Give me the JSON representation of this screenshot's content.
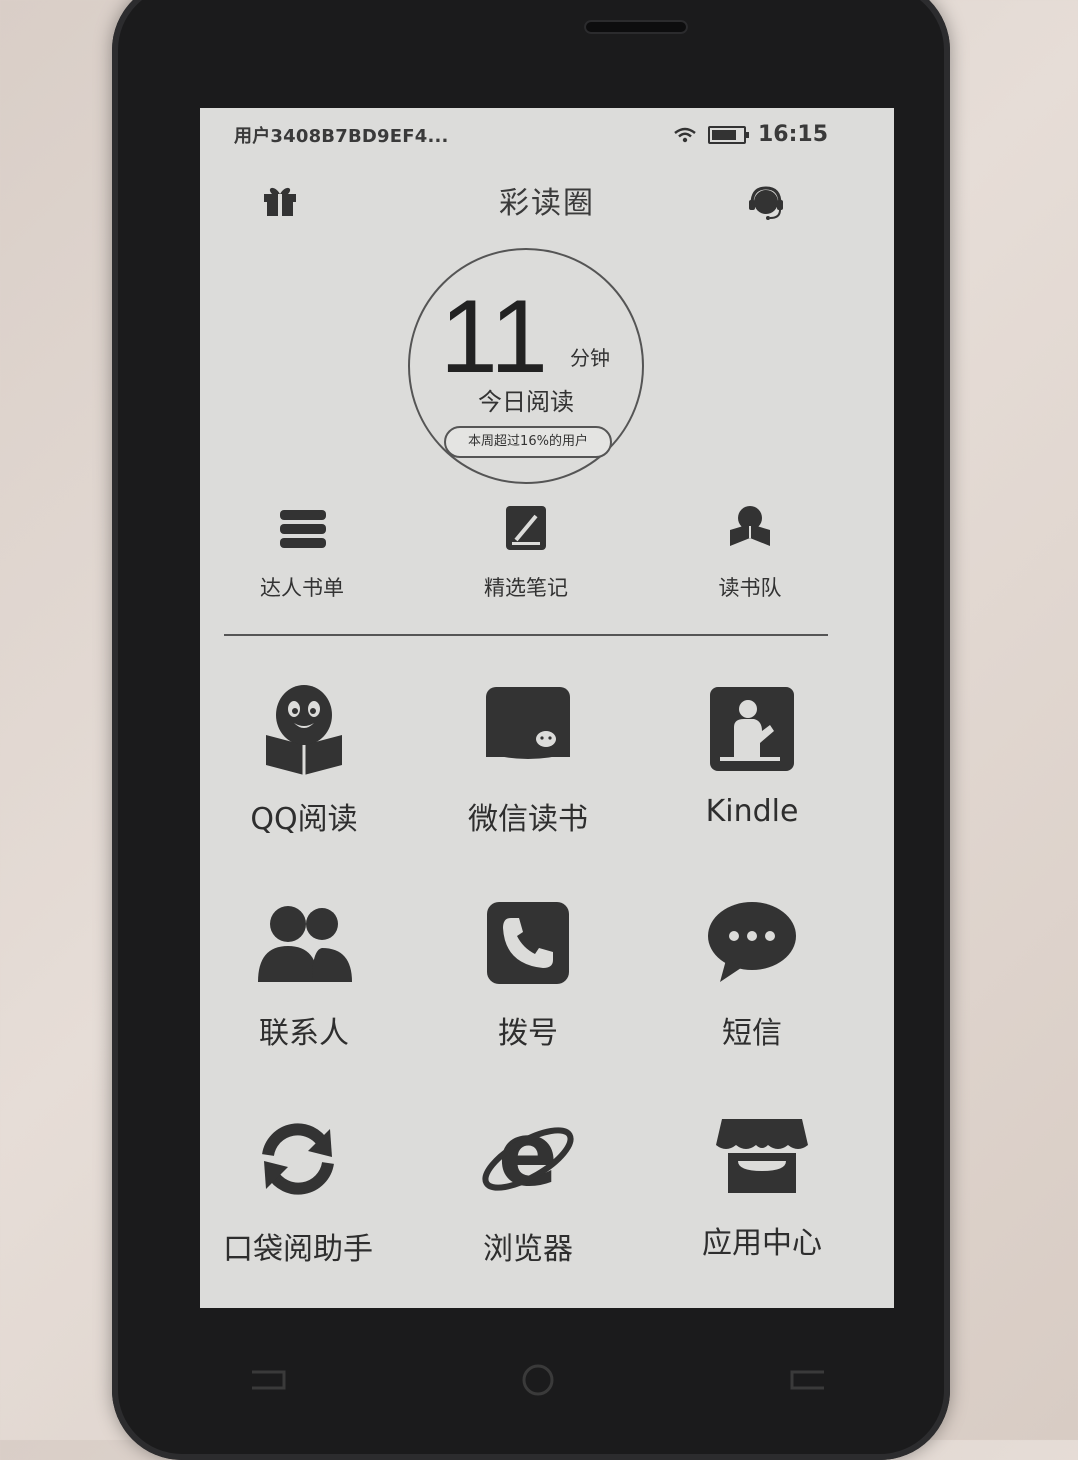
{
  "status_bar": {
    "user_label": "用户3408B7BD9EF4...",
    "time": "16:15"
  },
  "header": {
    "title": "彩读圈",
    "left_icon": "gift-icon",
    "right_icon": "headset-icon"
  },
  "reading_stats": {
    "minutes": "11",
    "unit": "分钟",
    "label": "今日阅读",
    "badge": "本周超过16%的用户"
  },
  "quick_links": [
    {
      "label": "达人书单",
      "icon": "stacked-books-icon"
    },
    {
      "label": "精选笔记",
      "icon": "note-edit-icon"
    },
    {
      "label": "读书队",
      "icon": "reading-person-icon"
    }
  ],
  "apps": [
    {
      "label": "QQ阅读",
      "icon": "qq-reading-icon"
    },
    {
      "label": "微信读书",
      "icon": "wechat-read-icon"
    },
    {
      "label": "Kindle",
      "icon": "kindle-icon"
    },
    {
      "label": "联系人",
      "icon": "contacts-icon"
    },
    {
      "label": "拨号",
      "icon": "phone-icon"
    },
    {
      "label": "短信",
      "icon": "message-icon"
    },
    {
      "label": "口袋阅助手",
      "icon": "sync-icon"
    },
    {
      "label": "浏览器",
      "icon": "browser-icon"
    },
    {
      "label": "应用中心",
      "icon": "app-store-icon"
    }
  ]
}
